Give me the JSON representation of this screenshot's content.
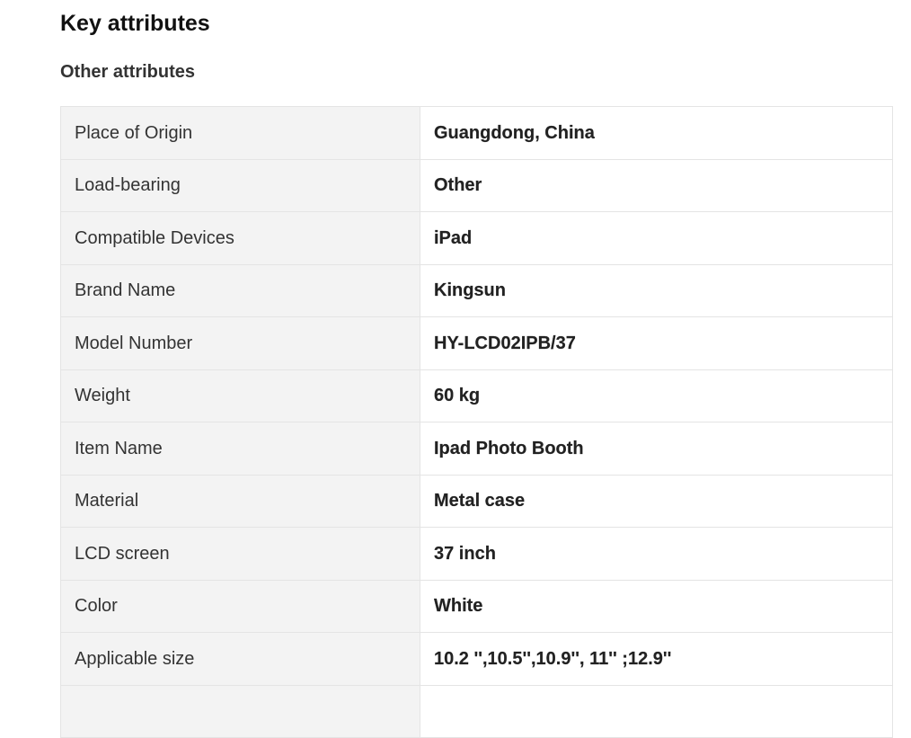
{
  "section": {
    "title": "Key attributes",
    "subtitle": "Other attributes"
  },
  "attributes": [
    {
      "label": "Place of Origin",
      "value": "Guangdong, China"
    },
    {
      "label": "Load-bearing",
      "value": "Other"
    },
    {
      "label": "Compatible Devices",
      "value": "iPad"
    },
    {
      "label": "Brand Name",
      "value": "Kingsun"
    },
    {
      "label": "Model Number",
      "value": "HY-LCD02IPB/37"
    },
    {
      "label": "Weight",
      "value": "60 kg"
    },
    {
      "label": "Item Name",
      "value": "Ipad Photo Booth"
    },
    {
      "label": "Material",
      "value": "Metal case"
    },
    {
      "label": "LCD screen",
      "value": "37 inch"
    },
    {
      "label": "Color",
      "value": "White"
    },
    {
      "label": "Applicable size",
      "value": "10.2 '',10.5'',10.9'', 11'' ;12.9''"
    },
    {
      "label": "",
      "value": ""
    }
  ]
}
